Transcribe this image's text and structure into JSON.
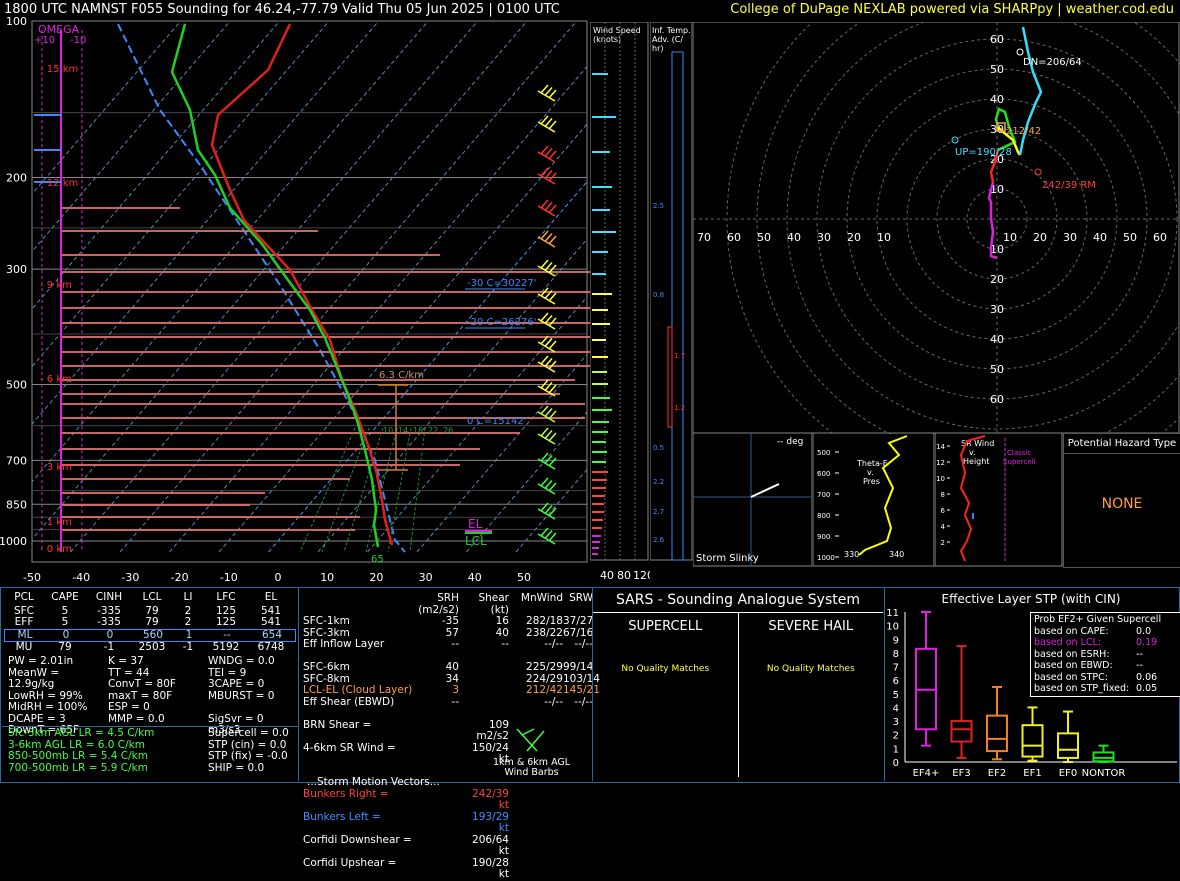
{
  "header": {
    "title": "1800 UTC NAMNST F055 Sounding for 46.24,-77.79 Valid  Thu 05 Jun 2025 | 0100 UTC",
    "credit": "College of DuPage NEXLAB powered via SHARPpy | weather.cod.edu"
  },
  "skewt": {
    "omega_label": "OMEGA",
    "omega_ticks": [
      "+10",
      "-10"
    ],
    "pressure_ticks": [
      "100",
      "200",
      "300",
      "500",
      "700",
      "850",
      "1000"
    ],
    "temp_ticks": [
      "-50",
      "-40",
      "-30",
      "-20",
      "-10",
      "0",
      "10",
      "20",
      "30",
      "40",
      "50"
    ],
    "height_labels": [
      "15 km",
      "12 km",
      "9 km",
      "6 km",
      "3 km",
      "1 km",
      "0 km"
    ],
    "lapse_label": "6.3 C/km",
    "isotherm_labels": [
      "-30 C=30227'",
      "-20 C=26276'",
      "0 C=15142'"
    ],
    "el_label": "EL",
    "lcl_label": "LCL",
    "sfc_dewpoint_label": "65",
    "mixing_ratio_labels": [
      "10",
      "14",
      "18",
      "22",
      "26"
    ]
  },
  "wind_speed": {
    "title": "Wind Speed\n(knots)",
    "title_line1": "Wind Speed",
    "title_line2": "(knots)",
    "ticks": [
      "40",
      "80",
      "120"
    ]
  },
  "inf_temp": {
    "title_line1": "Inf. Temp.",
    "title_line2": "Adv. (C/",
    "title_line3": "hr)",
    "values": [
      "2.5",
      "0.8",
      "1.7",
      "1.2",
      "0.5",
      "2.2",
      "2.7",
      "2.6"
    ]
  },
  "hodograph": {
    "axis_labels": [
      "70",
      "60",
      "50",
      "40",
      "30",
      "20",
      "10"
    ],
    "vert_labels": [
      "60",
      "50",
      "40",
      "30",
      "20",
      "10",
      "10",
      "20",
      "30",
      "40",
      "50",
      "60"
    ],
    "dn_label": "DN=206/64",
    "mean_label": "212/42",
    "up_label": "UP=190/28",
    "rm_label": "242/39 RM"
  },
  "slinky": {
    "title": "Storm Slinky",
    "deg": "-- deg"
  },
  "theta": {
    "label_line1": "Theta-E",
    "label_line2": "v.",
    "label_line3": "Pres",
    "pres_ticks": [
      "500",
      "600",
      "700",
      "800",
      "900",
      "1000"
    ],
    "x_ticks": [
      "330",
      "340"
    ]
  },
  "srwind": {
    "label_line1": "SR Wind",
    "label_line2": "v.",
    "label_line3": "Height",
    "classic_line1": "Classic",
    "classic_line2": "Supercell",
    "h_ticks": [
      "14",
      "12",
      "10",
      "8",
      "6",
      "4",
      "2"
    ]
  },
  "hazard": {
    "title": "Potential Hazard Type",
    "value": "NONE"
  },
  "parcel_table": {
    "headers": [
      "PCL",
      "CAPE",
      "CINH",
      "LCL",
      "LI",
      "LFC",
      "EL"
    ],
    "rows": [
      [
        "SFC",
        "5",
        "-335",
        "79",
        "2",
        "125",
        "541"
      ],
      [
        "EFF",
        "5",
        "-335",
        "79",
        "2",
        "125",
        "541"
      ],
      [
        "ML",
        "0",
        "0",
        "560",
        "1",
        "--",
        "654"
      ],
      [
        "MU",
        "79",
        "-1",
        "2503",
        "-1",
        "5192",
        "6748"
      ]
    ]
  },
  "indices": {
    "col1": [
      "PW = 2.01in",
      "MeanW = 12.9g/kg",
      "LowRH = 99%",
      "MidRH = 100%",
      "DCAPE = 3",
      "DownT = 65F"
    ],
    "col2": [
      "K = 37",
      "TT = 44",
      "ConvT = 80F",
      "maxT = 80F",
      "ESP = 0",
      "MMP = 0.0"
    ],
    "col3": [
      "WNDG = 0.0",
      "TEI = 9",
      "3CAPE = 0",
      "MBURST = 0",
      "",
      "SigSvr = 0 m3/s3"
    ],
    "lapse": [
      "Sfc-3km AGL LR = 4.5 C/km",
      "3-6km AGL LR = 6.0 C/km",
      "850-500mb LR = 5.4 C/km",
      "700-500mb LR = 5.9 C/km"
    ],
    "comp": [
      "Supercell = 0.0",
      "STP (cin) = 0.0",
      "STP (fix) = -0.0",
      "SHIP = 0.0"
    ]
  },
  "kinematics": {
    "headers": [
      "SRH (m2/s2)",
      "Shear (kt)",
      "MnWind",
      "SRW"
    ],
    "rows1": [
      [
        "SFC-1km",
        "-35",
        "16",
        "282/18",
        "37/27"
      ],
      [
        "SFC-3km",
        "57",
        "40",
        "238/22",
        "67/16"
      ],
      [
        "Eff Inflow Layer",
        "--",
        "--",
        "--/--",
        "--/--"
      ]
    ],
    "rows2": [
      [
        "SFC-6km",
        "40",
        "",
        "225/29",
        "99/14"
      ],
      [
        "SFC-8km",
        "34",
        "",
        "224/29",
        "103/14"
      ],
      [
        "LCL-EL (Cloud Layer)",
        "3",
        "",
        "212/42",
        "145/21"
      ],
      [
        "Eff Shear (EBWD)",
        "--",
        "",
        "--/--",
        "--/--"
      ]
    ],
    "brn": [
      "BRN Shear =",
      "109 m2/s2"
    ],
    "sr46": [
      "4-6km SR Wind =",
      "150/24 kt"
    ],
    "storm_title": "...Storm Motion Vectors...",
    "vectors": [
      [
        "Bunkers Right =",
        "242/39 kt"
      ],
      [
        "Bunkers Left =",
        "193/29 kt"
      ],
      [
        "Corfidi Downshear =",
        "206/64 kt"
      ],
      [
        "Corfidi Upshear =",
        "190/28 kt"
      ]
    ],
    "barb_label_line1": "1km & 6km AGL",
    "barb_label_line2": "Wind Barbs"
  },
  "sars": {
    "title": "SARS - Sounding Analogue System",
    "supercell": "SUPERCELL",
    "hail": "SEVERE HAIL",
    "no_match": "No Quality Matches"
  },
  "stp": {
    "title": "Effective Layer STP (with CIN)",
    "y_ticks": [
      "11",
      "10",
      "9",
      "8",
      "7",
      "6",
      "5",
      "4",
      "3",
      "2",
      "1",
      "0"
    ],
    "categories": [
      "EF4+",
      "EF3",
      "EF2",
      "EF1",
      "EF0",
      "NONTOR"
    ],
    "colors": [
      "#e020e0",
      "#e02020",
      "#f08020",
      "#f0f020",
      "#f0f020",
      "#20e020"
    ],
    "prob_title": "Prob EF2+ Given Supercell",
    "prob_rows": [
      [
        "based on CAPE:",
        "0.0"
      ],
      [
        "based on LCL:",
        "0.19"
      ],
      [
        "based on ESRH:",
        "--"
      ],
      [
        "based on EBWD:",
        "--"
      ],
      [
        "based on STPC:",
        "0.06"
      ],
      [
        "based on STP_fixed:",
        "0.05"
      ]
    ]
  },
  "chart_data": {
    "type": "line",
    "skewt_profile": {
      "pressure": [
        1000,
        950,
        900,
        850,
        800,
        700,
        600,
        500,
        400,
        300,
        250,
        200,
        150,
        100
      ],
      "temperature": [
        20,
        19,
        20,
        18,
        16,
        11,
        4,
        -4,
        -15,
        -28,
        -38,
        -48,
        -52,
        -56
      ],
      "dewpoint": [
        19,
        18,
        19,
        17,
        15,
        10,
        3,
        -5,
        -17,
        -33,
        -43,
        -52,
        -60,
        -62
      ]
    },
    "stp_boxes": [
      {
        "name": "EF4+",
        "low": 1.2,
        "q1": 2.4,
        "median": 5.3,
        "q3": 8.3,
        "high": 11.0
      },
      {
        "name": "EF3",
        "low": 0.3,
        "q1": 1.5,
        "median": 2.4,
        "q3": 3.0,
        "high": 8.5
      },
      {
        "name": "EF2",
        "low": 0.2,
        "q1": 0.8,
        "median": 1.7,
        "q3": 3.4,
        "high": 5.5
      },
      {
        "name": "EF1",
        "low": 0.1,
        "q1": 0.4,
        "median": 1.2,
        "q3": 2.7,
        "high": 4.0
      },
      {
        "name": "EF0",
        "low": 0.0,
        "q1": 0.3,
        "median": 0.9,
        "q3": 2.1,
        "high": 3.7
      },
      {
        "name": "NONTOR",
        "low": 0.0,
        "q1": 0.05,
        "median": 0.3,
        "q3": 0.7,
        "high": 1.2
      }
    ],
    "stp_ylim": [
      0,
      11
    ],
    "hodograph_points": [
      [
        0,
        0
      ],
      [
        -8,
        15
      ],
      [
        -3,
        24
      ],
      [
        -2,
        28
      ],
      [
        2,
        32
      ],
      [
        3,
        38
      ],
      [
        6,
        42
      ],
      [
        10,
        48
      ],
      [
        18,
        56
      ],
      [
        26,
        62
      ]
    ]
  }
}
